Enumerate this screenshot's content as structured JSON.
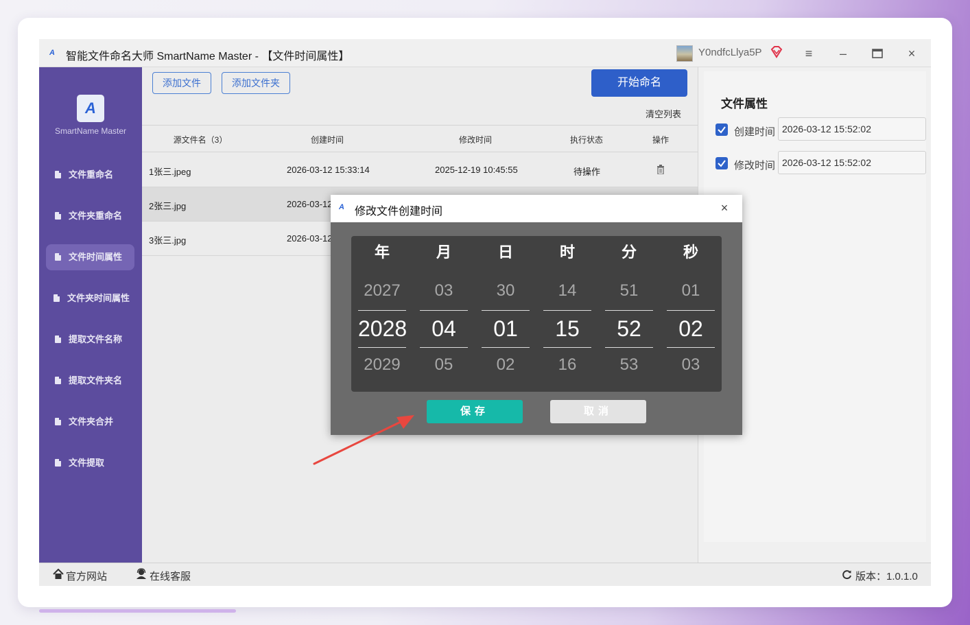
{
  "app": {
    "title": "智能文件命名大师 SmartName Master - 【文件时间属性】",
    "brand": "SmartName Master",
    "username": "Y0ndfcLlya5P"
  },
  "sidebar": {
    "items": [
      {
        "label": "文件重命名"
      },
      {
        "label": "文件夹重命名"
      },
      {
        "label": "文件时间属性"
      },
      {
        "label": "文件夹时间属性"
      },
      {
        "label": "提取文件名称"
      },
      {
        "label": "提取文件夹名"
      },
      {
        "label": "文件夹合并"
      },
      {
        "label": "文件提取"
      }
    ],
    "active_index": 2
  },
  "toolbar": {
    "add_file": "添加文件",
    "add_folder": "添加文件夹",
    "start": "开始命名",
    "clear_list": "清空列表"
  },
  "table": {
    "headers": [
      "源文件名（3）",
      "创建时间",
      "修改时间",
      "执行状态",
      "操作"
    ],
    "rows": [
      {
        "name": "1张三.jpeg",
        "created": "2026-03-12 15:33:14",
        "modified": "2025-12-19 10:45:55",
        "status": "待操作"
      },
      {
        "name": "2张三.jpg",
        "created": "2026-03-12",
        "modified": "",
        "status": ""
      },
      {
        "name": "3张三.jpg",
        "created": "2026-03-12",
        "modified": "",
        "status": ""
      }
    ]
  },
  "file_props": {
    "title": "文件属性",
    "created_label": "创建时间",
    "created_value": "2026-03-12 15:52:02",
    "modified_label": "修改时间",
    "modified_value": "2026-03-12 15:52:02"
  },
  "statusbar": {
    "website": "官方网站",
    "support": "在线客服",
    "version": "版本：1.0.1.0"
  },
  "dialog": {
    "title": "修改文件创建时间",
    "columns": [
      {
        "head": "年",
        "prev": "2027",
        "cur": "2028",
        "next": "2029"
      },
      {
        "head": "月",
        "prev": "03",
        "cur": "04",
        "next": "05"
      },
      {
        "head": "日",
        "prev": "30",
        "cur": "01",
        "next": "02"
      },
      {
        "head": "时",
        "prev": "14",
        "cur": "15",
        "next": "16"
      },
      {
        "head": "分",
        "prev": "51",
        "cur": "52",
        "next": "53"
      },
      {
        "head": "秒",
        "prev": "01",
        "cur": "02",
        "next": "03"
      }
    ],
    "save": "保存",
    "cancel": "取消"
  },
  "colors": {
    "sidebar": "#5c4c9e",
    "primary": "#2e5fc9",
    "save": "#16b9a9",
    "arrow": "#e8473f"
  }
}
